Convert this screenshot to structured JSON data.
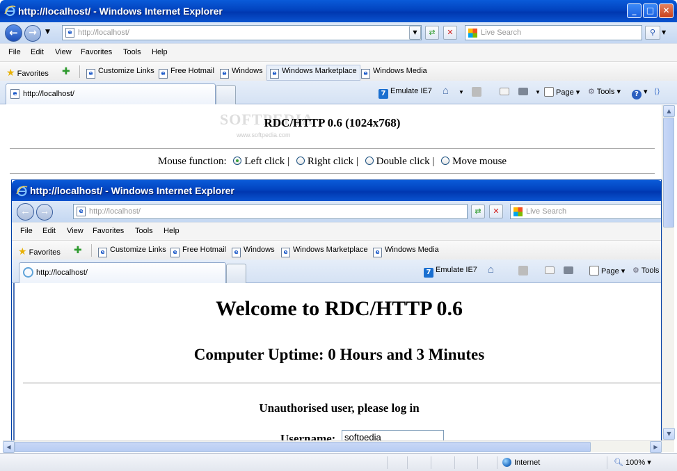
{
  "window": {
    "title": "http://localhost/ - Windows Internet Explorer",
    "address": "http://localhost/",
    "search_placeholder": "Live Search",
    "menu": [
      "File",
      "Edit",
      "View",
      "Favorites",
      "Tools",
      "Help"
    ],
    "favorites_label": "Favorites",
    "links": [
      "Customize Links",
      "Free Hotmail",
      "Windows",
      "Windows Marketplace",
      "Windows Media"
    ],
    "tab_title": "http://localhost/",
    "tools": {
      "emulate": "Emulate IE7",
      "page": "Page",
      "tools": "Tools"
    }
  },
  "page": {
    "heading": "RDC/HTTP 0.6 (1024x768)",
    "watermark": "SOFTPEDIA",
    "watermark_url": "www.softpedia.com",
    "mouse_label": "Mouse function:",
    "mouse_options": [
      "Left click",
      "Right click",
      "Double click",
      "Move mouse"
    ],
    "mouse_selected": "Left click",
    "separator": "|"
  },
  "remote": {
    "title": "http://localhost/ - Windows Internet Explorer",
    "address": "http://localhost/",
    "search_placeholder": "Live Search",
    "menu": [
      "File",
      "Edit",
      "View",
      "Favorites",
      "Tools",
      "Help"
    ],
    "favorites_label": "Favorites",
    "links": [
      "Customize Links",
      "Free Hotmail",
      "Windows",
      "Windows Marketplace",
      "Windows Media"
    ],
    "tab_title": "http://localhost/",
    "tools": {
      "emulate": "Emulate IE7",
      "page": "Page",
      "tools": "Tools"
    },
    "welcome": "Welcome to RDC/HTTP 0.6",
    "uptime": "Computer Uptime: 0 Hours and 3 Minutes",
    "auth_message": "Unauthorised user, please log in",
    "username_label": "Username:",
    "username_value": "softpedia"
  },
  "status": {
    "zone": "Internet",
    "zoom": "100%"
  },
  "colors": {
    "title_blue": "#0243bf",
    "radio_selected": "#3aa13a"
  }
}
